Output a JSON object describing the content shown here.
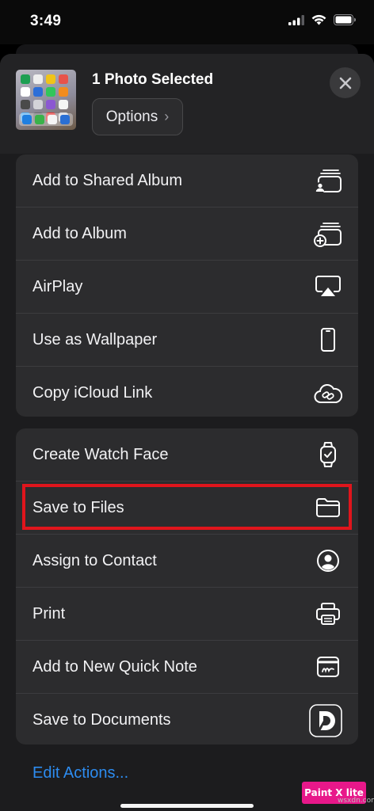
{
  "status_bar": {
    "time": "3:49",
    "icons": [
      "cellular-signal-icon",
      "wifi-icon",
      "battery-icon"
    ]
  },
  "header": {
    "title": "1 Photo Selected",
    "options_label": "Options",
    "options_chevron": "›",
    "close_icon": "close-icon"
  },
  "group1": [
    {
      "label": "Add to Shared Album",
      "icon": "shared-album-icon"
    },
    {
      "label": "Add to Album",
      "icon": "add-album-icon"
    },
    {
      "label": "AirPlay",
      "icon": "airplay-icon"
    },
    {
      "label": "Use as Wallpaper",
      "icon": "phone-icon"
    },
    {
      "label": "Copy iCloud Link",
      "icon": "cloud-link-icon"
    }
  ],
  "group2": [
    {
      "label": "Create Watch Face",
      "icon": "watch-icon"
    },
    {
      "label": "Save to Files",
      "icon": "folder-icon",
      "highlighted": true
    },
    {
      "label": "Assign to Contact",
      "icon": "contact-icon"
    },
    {
      "label": "Print",
      "icon": "printer-icon"
    },
    {
      "label": "Add to New Quick Note",
      "icon": "quick-note-icon"
    },
    {
      "label": "Save to Documents",
      "icon": "documents-app-icon"
    }
  ],
  "footer": {
    "edit_actions": "Edit Actions..."
  },
  "watermark": {
    "label": "Paint X lite",
    "sub": "wsxdn.com"
  },
  "colors": {
    "background": "#1c1c1e",
    "row_background": "#2c2c2e",
    "accent_link": "#2d8cf0",
    "highlight_border": "#e0151c",
    "watermark": "#e8188a"
  }
}
